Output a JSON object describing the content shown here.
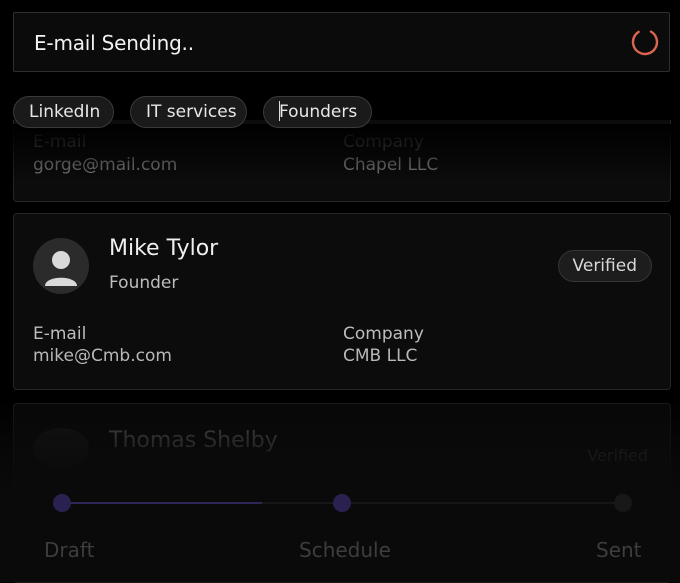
{
  "search": {
    "text": "E-mail Sending..",
    "status_icon": "loading-spinner-icon",
    "spinner_color": "#d9664f"
  },
  "filters": [
    {
      "label": "LinkedIn"
    },
    {
      "label": "IT services"
    },
    {
      "label": "Founders"
    }
  ],
  "contacts": [
    {
      "email_label": "E-mail",
      "email": "gorge@mail.com",
      "company_label": "Company",
      "company": "Chapel LLC"
    },
    {
      "name": "Mike Tylor",
      "role": "Founder",
      "badge": "Verified",
      "avatar_icon": "user-avatar-icon",
      "email_label": "E-mail",
      "email": "mike@Cmb.com",
      "company_label": "Company",
      "company": "CMB LLC"
    },
    {
      "name": "Thomas Shelby",
      "badge": "Verified",
      "avatar_icon": "user-avatar-icon"
    }
  ],
  "progress": {
    "steps": [
      {
        "label": "Draft"
      },
      {
        "label": "Schedule"
      },
      {
        "label": "Sent"
      }
    ],
    "current_step": 2,
    "accent_color": "#3e2f78"
  }
}
